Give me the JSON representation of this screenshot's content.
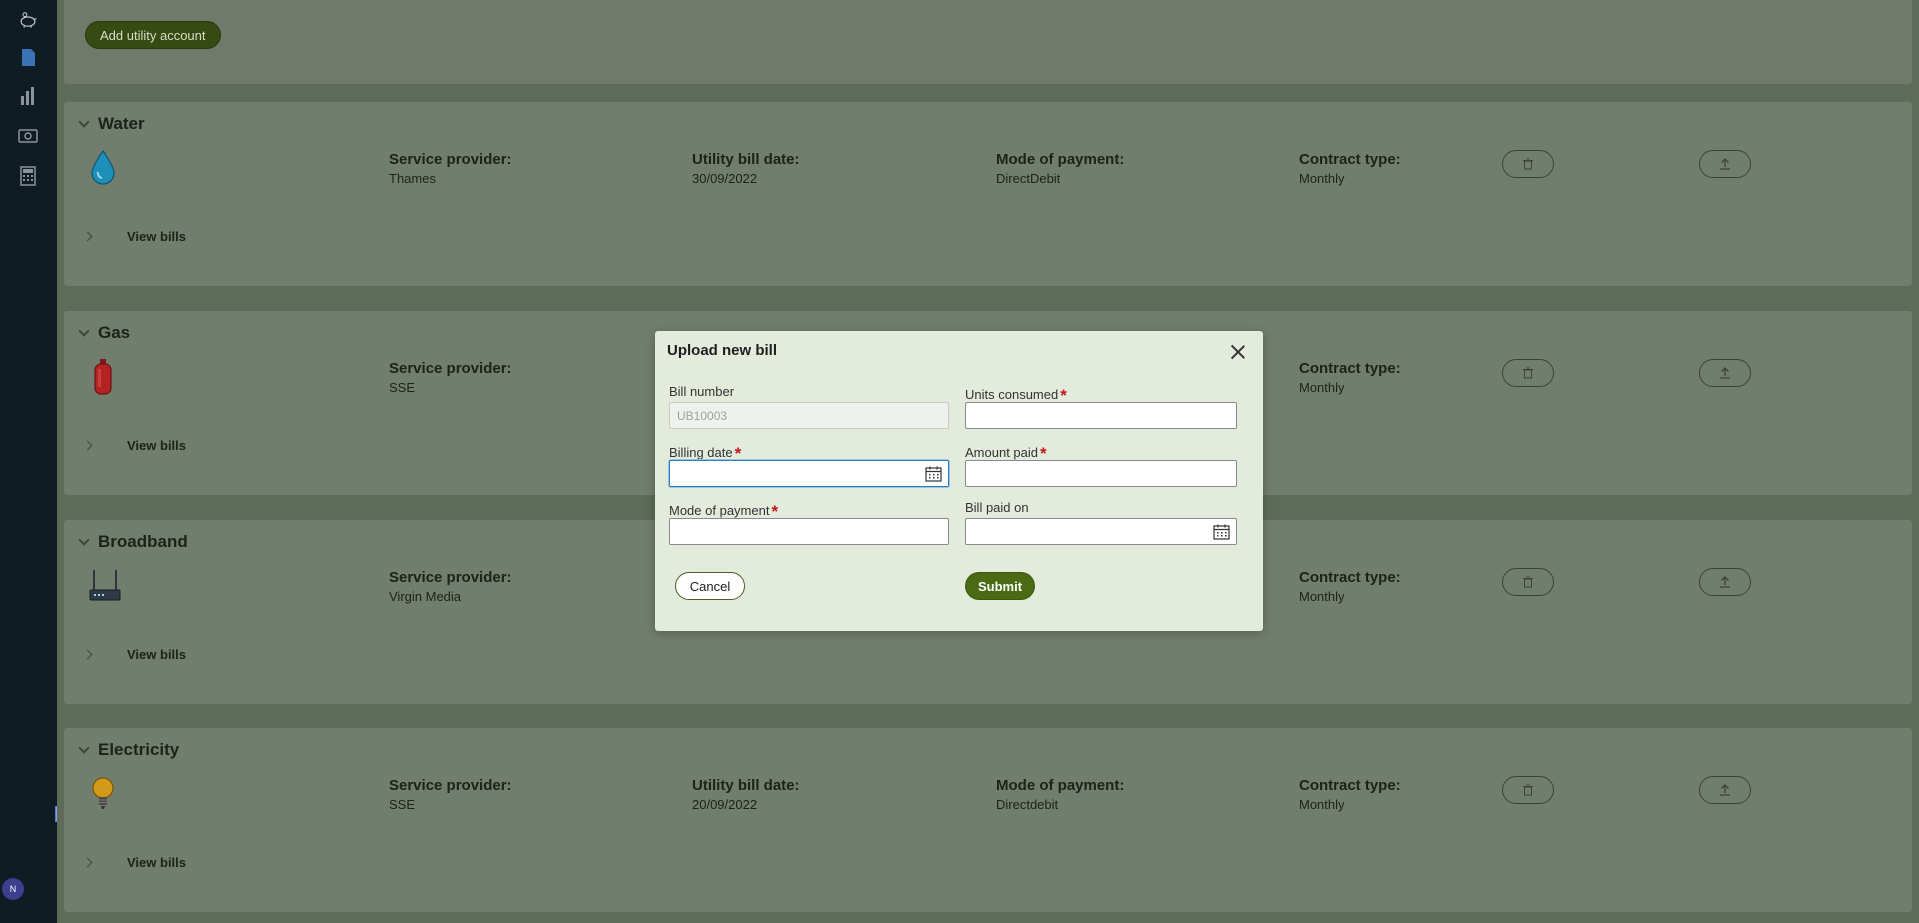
{
  "sidebar": {
    "icons": [
      "piggy-bank-icon",
      "document-icon",
      "chart-icon",
      "money-icon",
      "calculator-icon"
    ],
    "avatar_initial": "N"
  },
  "top": {
    "add_button": "Add utility account"
  },
  "utilities": [
    {
      "title": "Water",
      "icon": "water-drop-icon",
      "service_provider_label": "Service provider:",
      "service_provider": "Thames",
      "bill_date_label": "Utility bill date:",
      "bill_date": "30/09/2022",
      "payment_mode_label": "Mode of payment:",
      "payment_mode": "DirectDebit",
      "contract_label": "Contract type:",
      "contract": "Monthly",
      "view_bills": "View bills"
    },
    {
      "title": "Gas",
      "icon": "gas-cylinder-icon",
      "service_provider_label": "Service provider:",
      "service_provider": "SSE",
      "bill_date_label": "",
      "bill_date": "",
      "payment_mode_label": "",
      "payment_mode": "",
      "contract_label": "Contract type:",
      "contract": "Monthly",
      "view_bills": "View bills"
    },
    {
      "title": "Broadband",
      "icon": "router-icon",
      "service_provider_label": "Service provider:",
      "service_provider": "Virgin Media",
      "bill_date_label": "",
      "bill_date": "",
      "payment_mode_label": "",
      "payment_mode": "",
      "contract_label": "Contract type:",
      "contract": "Monthly",
      "view_bills": "View bills"
    },
    {
      "title": "Electricity",
      "icon": "light-bulb-icon",
      "service_provider_label": "Service provider:",
      "service_provider": "SSE",
      "bill_date_label": "Utility bill date:",
      "bill_date": "20/09/2022",
      "payment_mode_label": "Mode of payment:",
      "payment_mode": "Directdebit",
      "contract_label": "Contract type:",
      "contract": "Monthly",
      "view_bills": "View bills"
    }
  ],
  "modal": {
    "title": "Upload new bill",
    "bill_number_label": "Bill number",
    "bill_number_value": "UB10003",
    "units_label": "Units consumed",
    "billing_date_label": "Billing date",
    "amount_label": "Amount paid",
    "payment_mode_label": "Mode of payment",
    "paid_on_label": "Bill paid on",
    "required_mark": "*",
    "cancel": "Cancel",
    "submit": "Submit"
  }
}
